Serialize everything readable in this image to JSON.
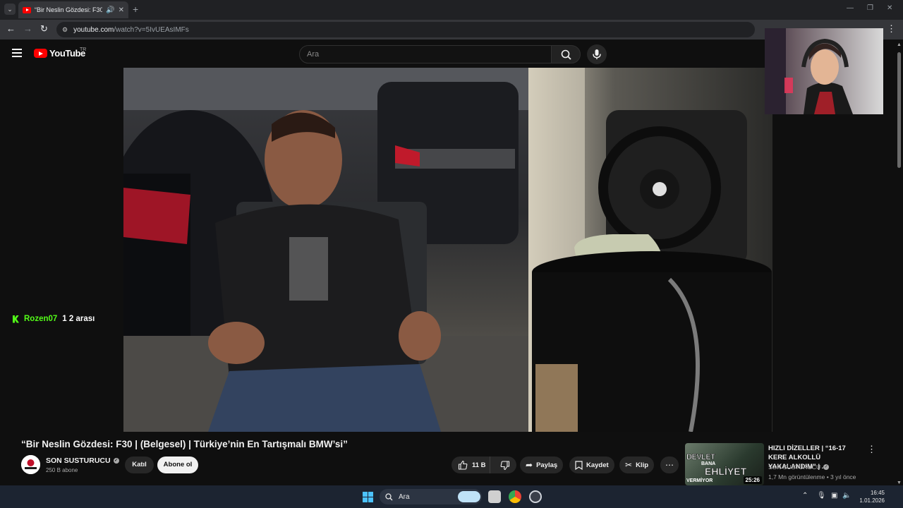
{
  "browser": {
    "tab_title": "“Bir Neslin Gözdesi: F30 | (B",
    "tab_audio_icon": "speaker-icon",
    "close_glyph": "✕",
    "new_tab_glyph": "+",
    "url_host": "youtube.com",
    "url_path": "/watch?v=5IvUEAsIMFs"
  },
  "youtube": {
    "logo_text": "YouTube",
    "region": "TR",
    "search_placeholder": "Ara",
    "accent": "#ff0000"
  },
  "chat": {
    "user": "Rozen07",
    "message": "1 2 arası",
    "user_color": "#53fc18"
  },
  "video": {
    "title": "“Bir Neslin Gözdesi: F30 | (Belgesel) | Türkiye’nin En Tartışmalı BMW’si”",
    "channel": "SON SUSTURUCU",
    "subscribers": "250 B abone",
    "join_label": "Katıl",
    "subscribe_label": "Abone ol",
    "likes": "11 B",
    "share_label": "Paylaş",
    "save_label": "Kaydet",
    "clip_label": "Klip",
    "more_glyph": "⋯"
  },
  "recommendation": {
    "title": "HIZLI DİZELLER | “16-17 KERE ALKOLLÜ YAKALANDIM” | ...",
    "channel": "SON SUSTURUCU",
    "views": "1,7 Mn görüntülenme",
    "age": "3 yıl önce",
    "duration": "25:26",
    "thumb_line1": "DEVLET",
    "thumb_line2": "BANA",
    "thumb_line3": "EHLİYET",
    "thumb_line4": "VERMİYOR"
  },
  "taskbar": {
    "search_placeholder": "Ara",
    "time": "16:45",
    "date": "1.01.2026",
    "accent": "#4cc2ff"
  }
}
